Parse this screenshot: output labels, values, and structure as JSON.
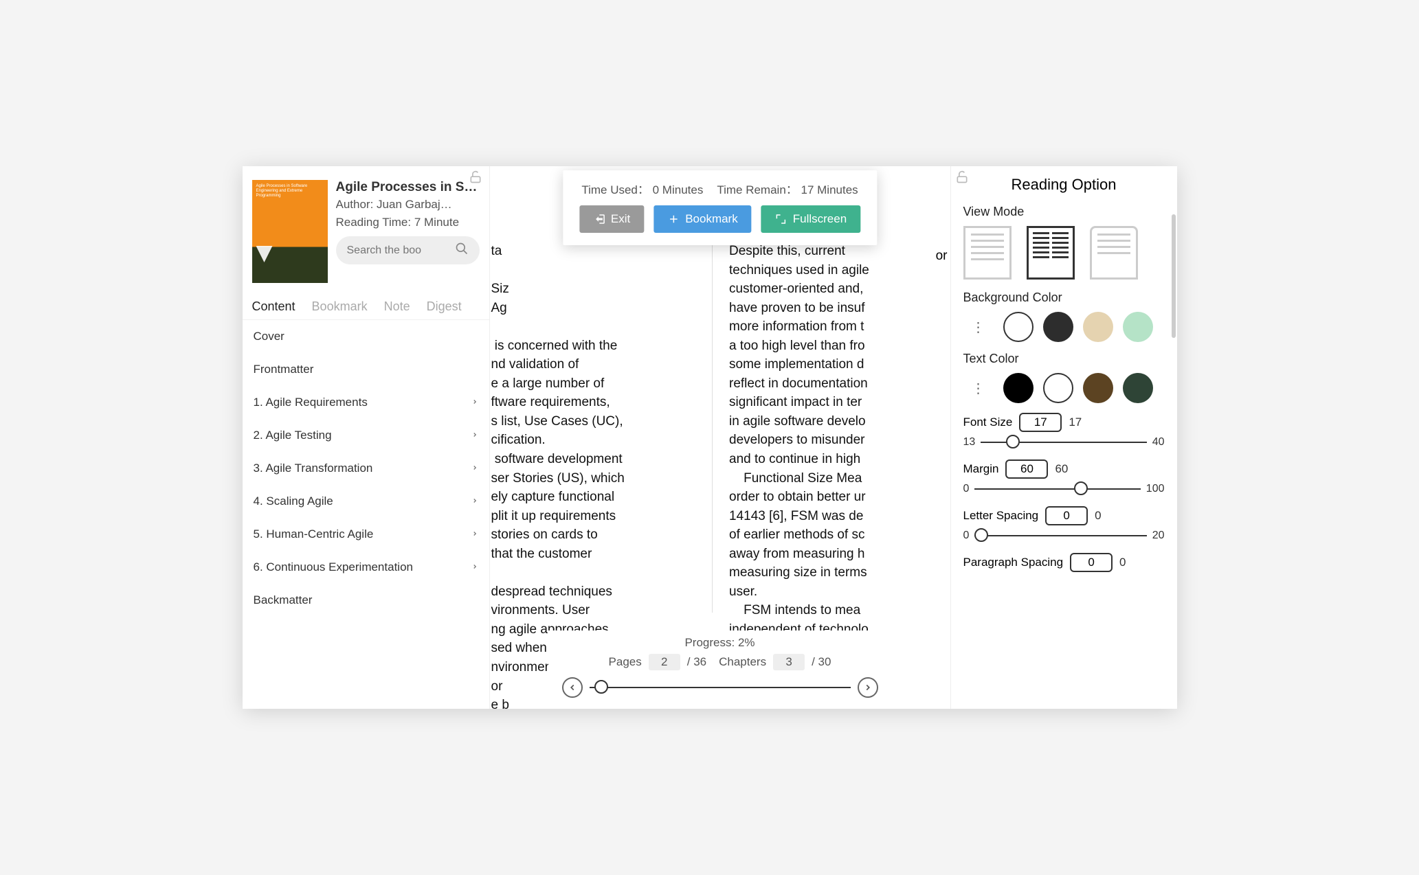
{
  "book": {
    "title": "Agile Processes in S…",
    "cover_text": "Agile Processes in Software Engineering and Extreme Programming",
    "author_label": "Author: Juan Garbaj…",
    "reading_time": "Reading Time: 7 Minute",
    "search_placeholder": "Search the boo"
  },
  "tabs": [
    "Content",
    "Bookmark",
    "Note",
    "Digest"
  ],
  "toc": [
    {
      "label": "Cover",
      "expandable": false
    },
    {
      "label": "Frontmatter",
      "expandable": false
    },
    {
      "label": "1. Agile Requirements",
      "expandable": true
    },
    {
      "label": "2. Agile Testing",
      "expandable": true
    },
    {
      "label": "3. Agile Transformation",
      "expandable": true
    },
    {
      "label": "4. Scaling Agile",
      "expandable": true
    },
    {
      "label": "5. Human-Centric Agile",
      "expandable": true
    },
    {
      "label": "6. Continuous Experimentation",
      "expandable": true
    },
    {
      "label": "Backmatter",
      "expandable": false
    }
  ],
  "topbar": {
    "time_used_label": "Time Used：",
    "time_used_value": "0 Minutes",
    "time_remain_label": "Time Remain：",
    "time_remain_value": "17 Minutes",
    "exit": "Exit",
    "bookmark": "Bookmark",
    "fullscreen": "Fullscreen"
  },
  "reader": {
    "left_visible_text": "ta\n\nSiz\nAg\n\n is concerned with the\nnd validation of\ne a large number of\nftware requirements,\ns list, Use Cases (UC),\ncification.\n software development\nser Stories (US), which\nely capture functional\nplit it up requirements\nstories on cards to\nthat the customer\n\ndespread techniques\nvironments. User\nng agile approaches,\nsed when the subject is\nnvironments. There is\nor\ne b",
    "right_visible_text": "Despite this, current\ntechniques used in agile\ncustomer-oriented and,\nhave proven to be insuf\nmore information from t\na too high level than fro\nsome implementation d\nreflect in documentation\nsignificant impact in ter\nin agile software develo\ndevelopers to misunder\nand to continue in high\n    Functional Size Mea\norder to obtain better ur\n14143 [6], FSM was de\nof earlier methods of sc\naway from measuring h\nmeasuring size in terms\nuser.\n    FSM intends to mea\nindependent of technolo\n                              en\n                             cti",
    "trailing_fragment": "or"
  },
  "progress": {
    "label": "Progress: 2%",
    "pages_label": "Pages",
    "page_current": "2",
    "page_total": "/ 36",
    "chapters_label": "Chapters",
    "chapter_current": "3",
    "chapter_total": "/ 30"
  },
  "options": {
    "title": "Reading Option",
    "view_mode_label": "View Mode",
    "bg_label": "Background Color",
    "bg_colors": [
      "#ffffff",
      "#2d2d2d",
      "#e5d3b0",
      "#b5e3c7"
    ],
    "text_label": "Text Color",
    "text_colors": [
      "#000000",
      "#ffffff",
      "#5c4322",
      "#2e4436"
    ],
    "font_size": {
      "label": "Font Size",
      "value": "17",
      "min": "13",
      "max": "40",
      "pct": 15
    },
    "margin": {
      "label": "Margin",
      "value": "60",
      "min": "0",
      "max": "100",
      "pct": 60
    },
    "letter": {
      "label": "Letter Spacing",
      "value": "0",
      "min": "0",
      "max": "20",
      "pct": 0
    },
    "para": {
      "label": "Paragraph Spacing",
      "value": "0",
      "echo": "0"
    }
  }
}
